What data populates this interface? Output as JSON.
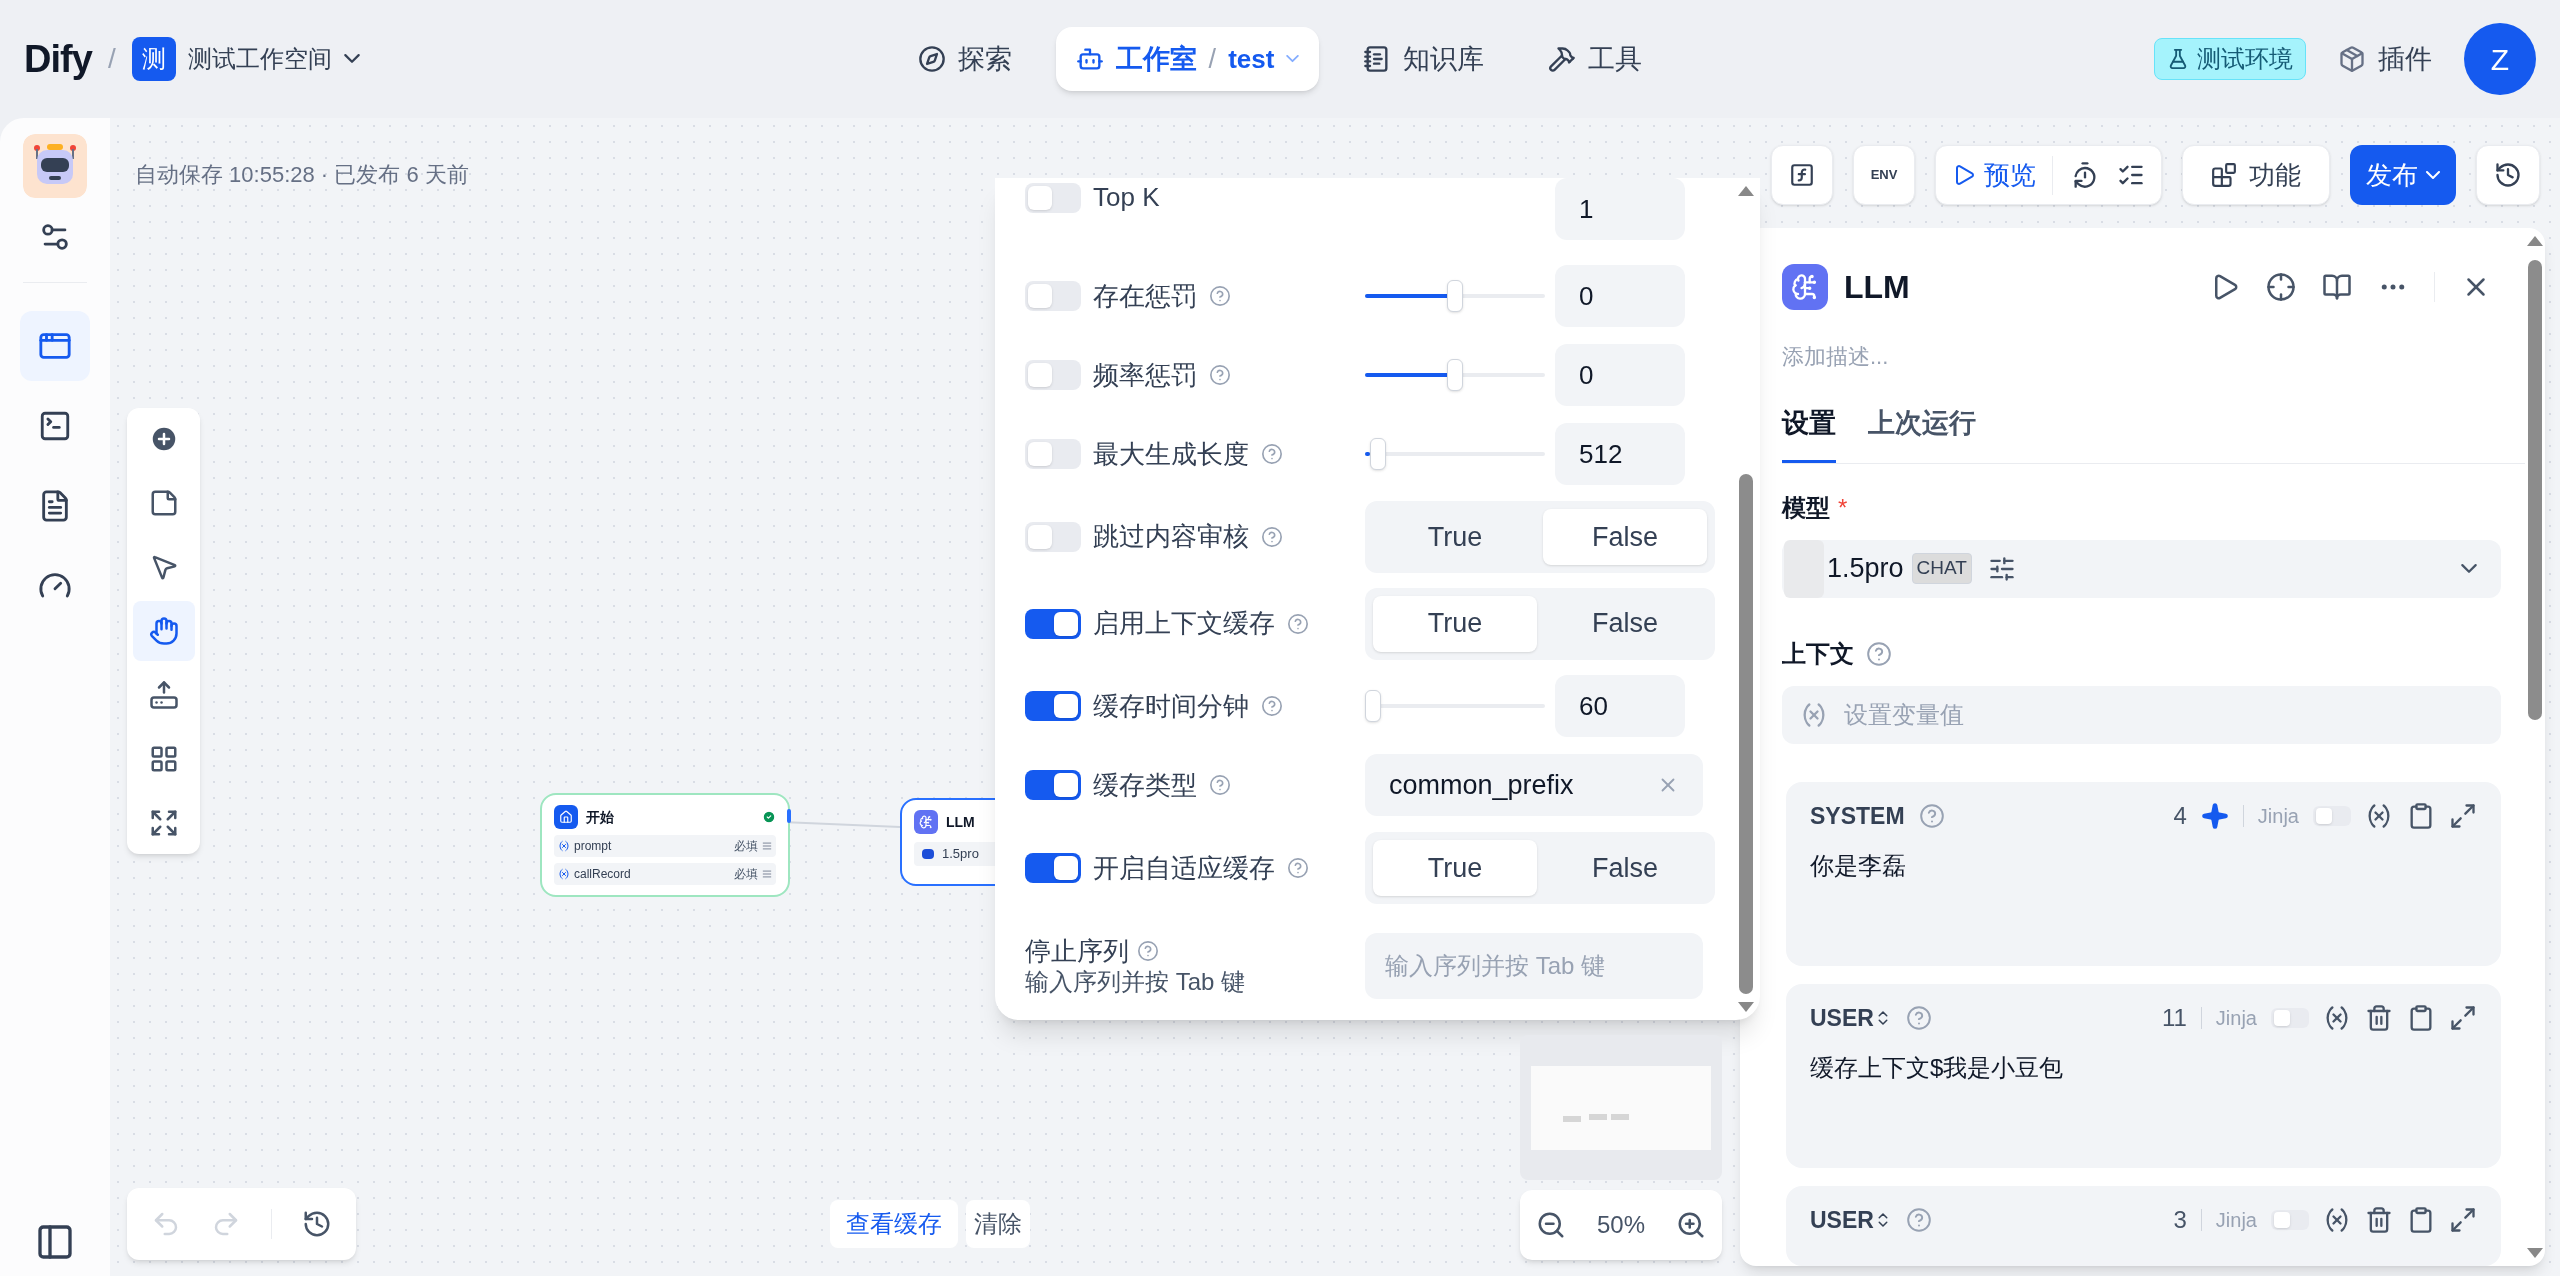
{
  "header": {
    "logo": "Dify",
    "separator": "/",
    "workspace_icon": "测",
    "workspace": "测试工作空间",
    "nav": [
      {
        "label": "探索",
        "selected": false,
        "kind": "explore"
      },
      {
        "label": "工作室",
        "selected": true,
        "kind": "studio",
        "separator": "/",
        "app": "test"
      },
      {
        "label": "知识库",
        "selected": false,
        "kind": "knowledge"
      },
      {
        "label": "工具",
        "selected": false,
        "kind": "tools"
      }
    ],
    "env_badge": "测试环境",
    "plugins": "插件",
    "avatar": "Z"
  },
  "status": "自动保存 10:55:28 · 已发布 6 天前",
  "toolbar": {
    "env": "ENV",
    "preview": "预览",
    "features": "功能",
    "publish": "发布"
  },
  "nodes": [
    {
      "title": "开始",
      "kind": "start",
      "ok": true,
      "variables": [
        {
          "name": "prompt",
          "tag": "必填"
        },
        {
          "name": "callRecord",
          "tag": "必填"
        }
      ]
    },
    {
      "title": "LLM",
      "kind": "llm",
      "model": "1.5pro"
    }
  ],
  "params": [
    {
      "label": "Top K",
      "kind": "number",
      "enabled": false,
      "help": false,
      "value": "1"
    },
    {
      "label": "存在惩罚",
      "kind": "slider",
      "enabled": false,
      "help": true,
      "level": 0.5,
      "value": "0"
    },
    {
      "label": "频率惩罚",
      "kind": "slider",
      "enabled": false,
      "help": true,
      "level": 0.5,
      "value": "0"
    },
    {
      "label": "最大生成长度",
      "kind": "slider",
      "enabled": false,
      "help": true,
      "level": 0.03,
      "value": "512"
    },
    {
      "label": "跳过内容审核",
      "kind": "boolean",
      "enabled": false,
      "help": true,
      "options": [
        {
          "label": "True",
          "selected": false
        },
        {
          "label": "False",
          "selected": true
        }
      ]
    },
    {
      "label": "启用上下文缓存",
      "kind": "boolean",
      "enabled": true,
      "help": true,
      "options": [
        {
          "label": "True",
          "selected": true
        },
        {
          "label": "False",
          "selected": false
        }
      ]
    },
    {
      "label": "缓存时间分钟",
      "kind": "slider",
      "enabled": true,
      "help": true,
      "level": 0,
      "value": "60"
    },
    {
      "label": "缓存类型",
      "kind": "select",
      "enabled": true,
      "help": true,
      "value": "common_prefix"
    },
    {
      "label": "开启自适应缓存",
      "kind": "boolean",
      "enabled": true,
      "help": true,
      "options": [
        {
          "label": "True",
          "selected": true
        },
        {
          "label": "False",
          "selected": false
        }
      ]
    }
  ],
  "stop": {
    "label": "停止序列",
    "hint": "输入序列并按 Tab 键",
    "placeholder": "输入序列并按 Tab 键"
  },
  "cache": {
    "view": "查看缓存",
    "clear": "清除"
  },
  "zoom": "50%",
  "panel": {
    "title": "LLM",
    "description_placeholder": "添加描述...",
    "tabs": [
      {
        "label": "设置",
        "selected": true
      },
      {
        "label": "上次运行",
        "selected": false
      }
    ],
    "model_label": "模型",
    "required_mark": "*",
    "model": {
      "name": "1.5pro",
      "mode": "CHAT"
    },
    "context_label": "上下文",
    "context_placeholder": "设置变量值",
    "prompts": [
      {
        "role": "SYSTEM",
        "kind": "system",
        "count": "4",
        "jinja_label": "Jinja",
        "jinja": false,
        "text": "你是李磊"
      },
      {
        "role": "USER",
        "kind": "message",
        "count": "11",
        "jinja_label": "Jinja",
        "jinja": false,
        "text": "缓存上下文$我是小豆包"
      },
      {
        "role": "USER",
        "kind": "message",
        "count": "3",
        "jinja_label": "Jinja",
        "jinja": false
      }
    ]
  }
}
